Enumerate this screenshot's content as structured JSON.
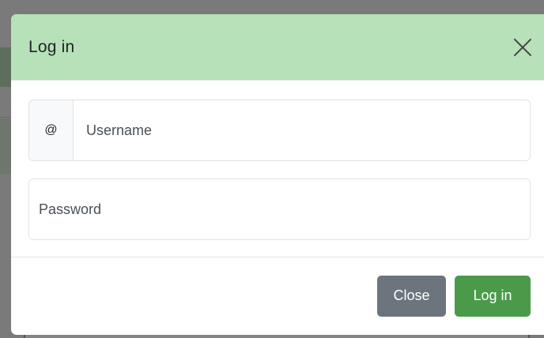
{
  "modal": {
    "title": "Log in",
    "close_icon": "close-icon"
  },
  "form": {
    "username_addon": "@",
    "username_placeholder": "Username",
    "username_value": "",
    "password_placeholder": "Password",
    "password_value": ""
  },
  "footer": {
    "close_label": "Close",
    "login_label": "Log in"
  },
  "colors": {
    "header_bg": "#b7e1b9",
    "primary_button": "#4a9a4a",
    "secondary_button": "#6c757d",
    "backdrop": "#7a7a7a"
  }
}
